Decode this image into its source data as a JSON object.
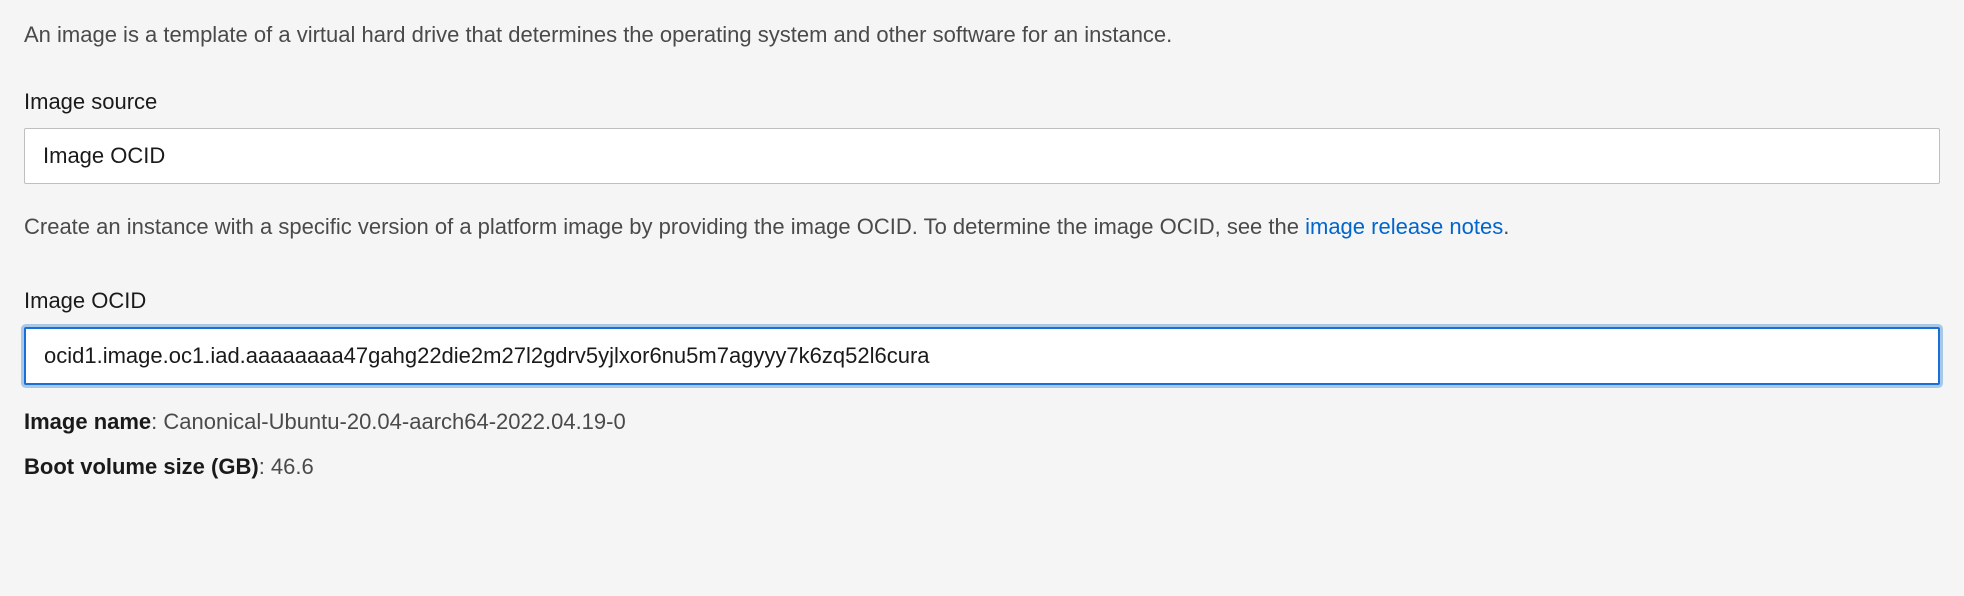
{
  "intro_description": "An image is a template of a virtual hard drive that determines the operating system and other software for an instance.",
  "image_source": {
    "label": "Image source",
    "value": "Image OCID"
  },
  "helper": {
    "prefix": "Create an instance with a specific version of a platform image by providing the image OCID. To determine the image OCID, see the ",
    "link_text": "image release notes",
    "suffix": "."
  },
  "image_ocid": {
    "label": "Image OCID",
    "value": "ocid1.image.oc1.iad.aaaaaaaa47gahg22die2m27l2gdrv5yjlxor6nu5m7agyyy7k6zq52l6cura"
  },
  "details": {
    "image_name": {
      "label": "Image name",
      "value": "Canonical-Ubuntu-20.04-aarch64-2022.04.19-0"
    },
    "boot_volume": {
      "label": "Boot volume size (GB)",
      "value": "46.6"
    }
  }
}
